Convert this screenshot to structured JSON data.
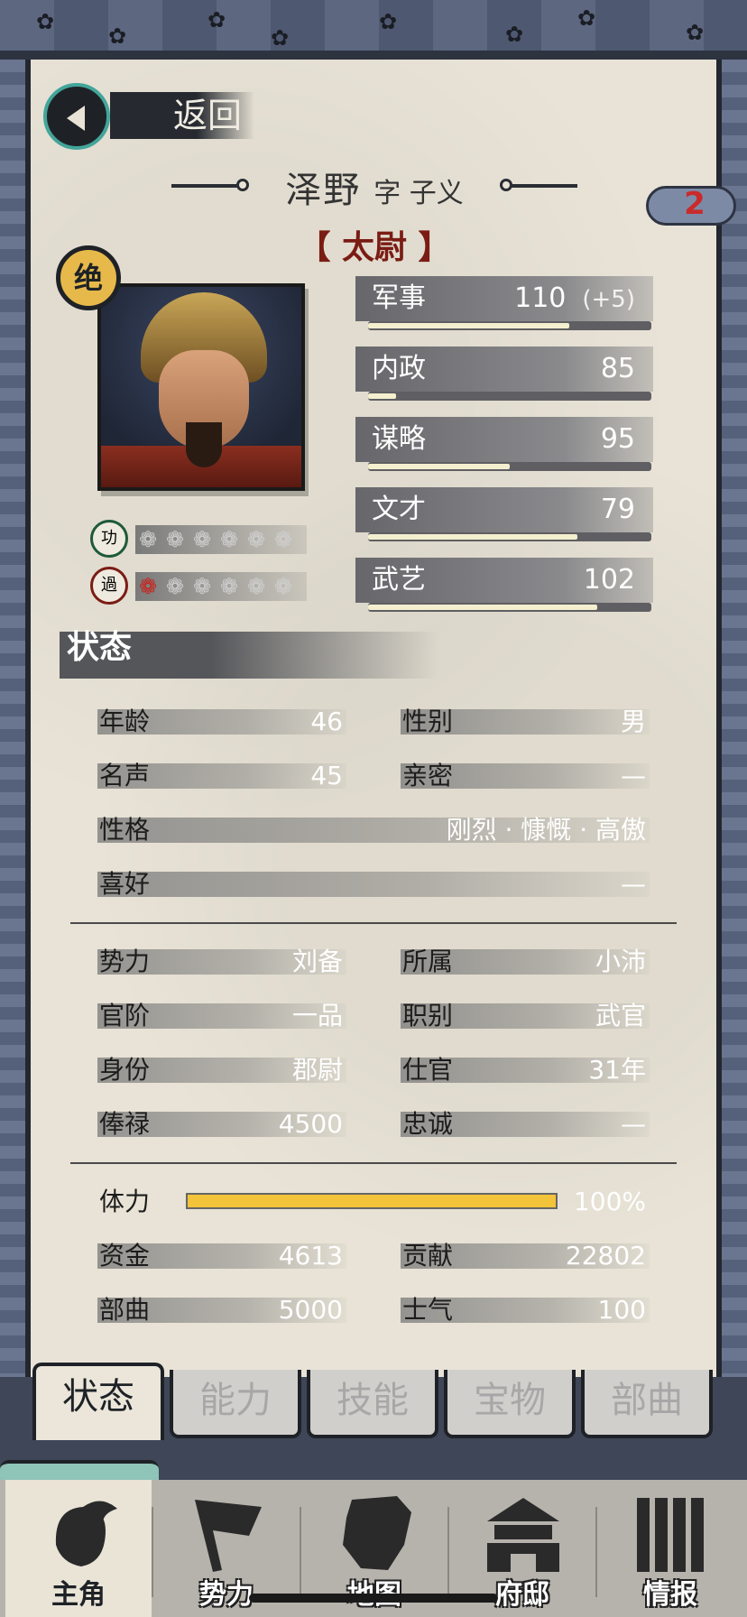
{
  "header": {
    "back_label": "返回",
    "name": "泽野",
    "courtesy": "字 子义",
    "title": "【 太尉 】",
    "badge": "绝",
    "cloud_count": "2"
  },
  "merit": {
    "gong_label": "功",
    "guo_label": "過",
    "gong_filled": 0,
    "guo_filled": 1,
    "total": 6
  },
  "attributes": [
    {
      "label": "军事",
      "value": "110",
      "bonus": "(+5)",
      "fill": 0.71
    },
    {
      "label": "内政",
      "value": "85",
      "bonus": "",
      "fill": 0.1
    },
    {
      "label": "谋略",
      "value": "95",
      "bonus": "",
      "fill": 0.5
    },
    {
      "label": "文才",
      "value": "79",
      "bonus": "",
      "fill": 0.74
    },
    {
      "label": "武艺",
      "value": "102",
      "bonus": "",
      "fill": 0.81
    }
  ],
  "status": {
    "heading": "状态",
    "age_label": "年龄",
    "age": "46",
    "gender_label": "性别",
    "gender": "男",
    "fame_label": "名声",
    "fame": "45",
    "intimacy_label": "亲密",
    "intimacy": "—",
    "personality_label": "性格",
    "personality": "刚烈 · 慷慨 · 高傲",
    "hobby_label": "喜好",
    "hobby": "—",
    "faction_label": "势力",
    "faction": "刘备",
    "belong_label": "所属",
    "belong": "小沛",
    "rank_label": "官阶",
    "rank": "一品",
    "post_label": "职别",
    "post": "武官",
    "identity_label": "身份",
    "identity": "郡尉",
    "service_label": "仕官",
    "service": "31年",
    "salary_label": "俸禄",
    "salary": "4500",
    "loyalty_label": "忠诚",
    "loyalty": "—",
    "stamina_label": "体力",
    "stamina": "100%",
    "stamina_fill": 1.0,
    "funds_label": "资金",
    "funds": "4613",
    "contribution_label": "贡献",
    "contribution": "22802",
    "troops_label": "部曲",
    "troops": "5000",
    "morale_label": "士气",
    "morale": "100"
  },
  "tabs": [
    "状态",
    "能力",
    "技能",
    "宝物",
    "部曲"
  ],
  "nav": [
    "主角",
    "势力",
    "地图",
    "府邸",
    "情报"
  ],
  "colors": {
    "accent_gold": "#f3c33a",
    "title_red": "#7a1c14",
    "teal": "#43a59a"
  }
}
